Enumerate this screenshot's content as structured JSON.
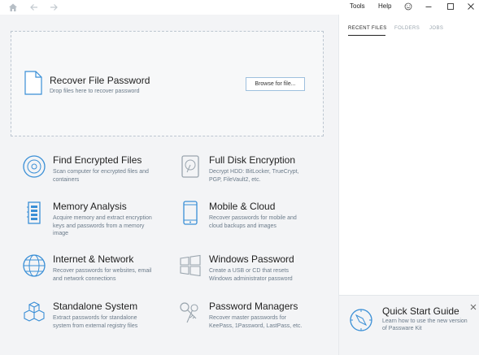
{
  "titlebar": {
    "home_icon": "home-icon",
    "back_icon": "arrow-left-icon",
    "forward_icon": "arrow-right-icon",
    "menu": [
      "Tools",
      "Help"
    ],
    "smiley_icon": "smiley-icon",
    "minimize_icon": "minimize-icon",
    "maximize_icon": "maximize-icon",
    "close_icon": "close-icon"
  },
  "dropzone": {
    "title": "Recover File Password",
    "subtitle": "Drop files here to recover password",
    "browse_label": "Browse for file..."
  },
  "tiles": [
    {
      "title": "Find Encrypted Files",
      "desc": "Scan computer for encrypted files and containers",
      "icon": "disc-icon"
    },
    {
      "title": "Full Disk Encryption",
      "desc": "Decrypt HDD: BitLocker, TrueCrypt, PGP, FileVault2, etc.",
      "icon": "hard-disk-icon"
    },
    {
      "title": "Memory Analysis",
      "desc": "Acquire memory and extract encryption keys and passwords from a memory image",
      "icon": "memory-icon"
    },
    {
      "title": "Mobile & Cloud",
      "desc": "Recover passwords for mobile and cloud backups and images",
      "icon": "mobile-icon"
    },
    {
      "title": "Internet & Network",
      "desc": "Recover passwords for websites, email and network connections",
      "icon": "globe-icon"
    },
    {
      "title": "Windows Password",
      "desc": "Create a USB or CD that resets Windows administrator password",
      "icon": "windows-icon"
    },
    {
      "title": "Standalone System",
      "desc": "Extract passwords for standalone system from external registry files",
      "icon": "cubes-icon"
    },
    {
      "title": "Password Managers",
      "desc": "Recover master passwords for KeePass, 1Password, LastPass, etc.",
      "icon": "keys-icon"
    }
  ],
  "side": {
    "tabs": [
      "RECENT FILES",
      "FOLDERS",
      "JOBS"
    ],
    "active_tab": "RECENT FILES"
  },
  "quick_start": {
    "title": "Quick Start Guide",
    "desc": "Learn how to use the new version of Passware Kit",
    "icon": "compass-icon"
  },
  "colors": {
    "accent": "#3a8fd6",
    "icon_gray": "#9aa5ae",
    "text_muted": "#6b7b8a"
  }
}
